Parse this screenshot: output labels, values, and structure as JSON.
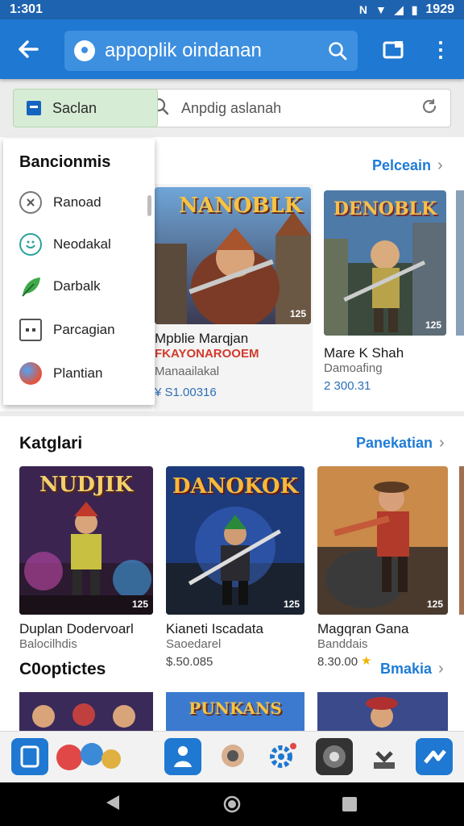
{
  "status": {
    "time": "1:301",
    "clock_right": "1929"
  },
  "appbar": {
    "query": "appoplik oindanan"
  },
  "filter": {
    "chip_label": "Saclan",
    "placeholder": "Anpdig aslanah"
  },
  "dropdown": {
    "title": "Bancionmis",
    "items": [
      {
        "label": "Ranoad",
        "icon": "clock-icon"
      },
      {
        "label": "Neodakal",
        "icon": "smile-icon"
      },
      {
        "label": "Darbalk",
        "icon": "leaf-icon"
      },
      {
        "label": "Parcagian",
        "icon": "chat-icon"
      },
      {
        "label": "Plantian",
        "icon": "globe-icon"
      }
    ]
  },
  "featured": {
    "see_all": "Pelceain",
    "games": [
      {
        "title_art": "NANOBLK",
        "name": "Mpblie Marqjan",
        "subtitle": "FKAYONAROOEM",
        "dev": "Manaailakal",
        "price": "¥ S1.00316",
        "badge": "125"
      },
      {
        "title_art": "DENOBLK",
        "name": "Mare K Shah",
        "subtitle": "",
        "dev": "Damoafing",
        "price": "2 300.31",
        "badge": "125"
      }
    ]
  },
  "categories": {
    "title": "Katglari",
    "see_all": "Panekatian",
    "games": [
      {
        "title_art": "NUDJIK",
        "name": "Duplan Dodervoarl",
        "dev": "Balocilhdis",
        "price": "",
        "badge": "125"
      },
      {
        "title_art": "DANOKOK",
        "name": "Kianeti Iscadata",
        "dev": "Saoedarel",
        "price": "$.50.085",
        "badge": "125"
      },
      {
        "title_art": "",
        "name": "Magqran Gana",
        "dev": "Banddais",
        "price": "8.30.00",
        "badge": "125"
      }
    ]
  },
  "section3": {
    "title": "C0optictes",
    "see_all": "Bmakia",
    "banner_text": "PUNKANS"
  },
  "colors": {
    "appbar": "#1f78d1",
    "statusbar": "#1e63b0",
    "accent": "#1e7bd6"
  }
}
